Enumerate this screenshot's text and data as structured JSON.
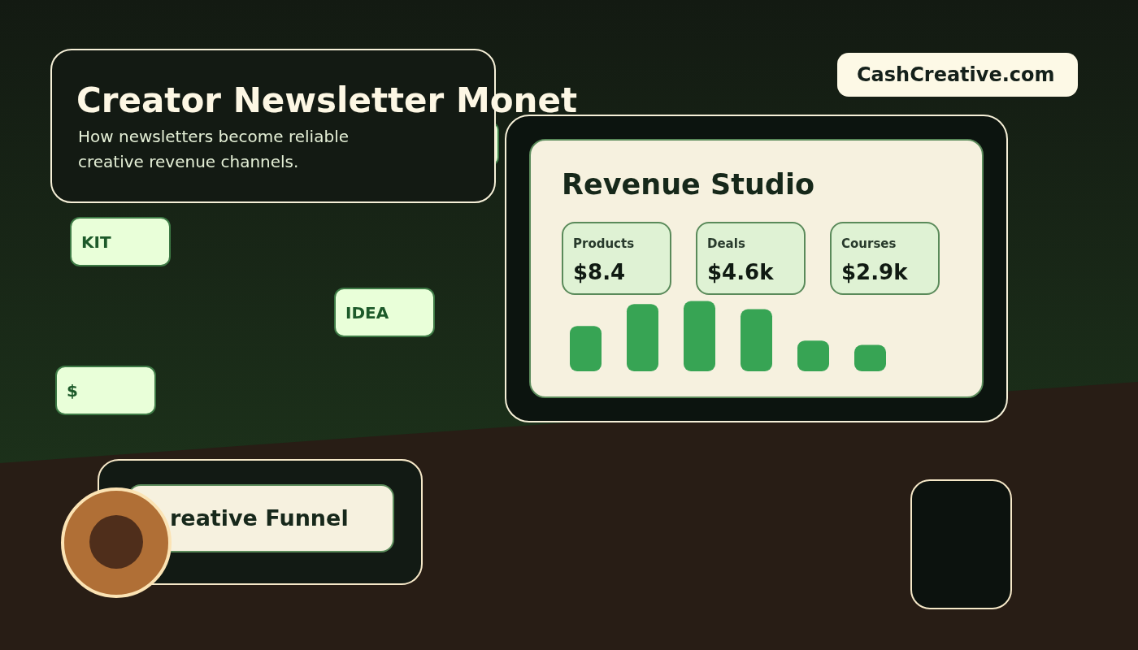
{
  "hero": {
    "title": "Creator Newsletter Monet",
    "subtitle": "How newsletters become reliable creative revenue channels."
  },
  "brand": "CashCreative.com",
  "tags": [
    {
      "label": "KIT"
    },
    {
      "label": "IDEA"
    },
    {
      "label": "$"
    }
  ],
  "dashboard": {
    "title": "Revenue Studio",
    "stats": [
      {
        "label": "Products",
        "value": "$8.4"
      },
      {
        "label": "Deals",
        "value": "$4.6k"
      },
      {
        "label": "Courses",
        "value": "$2.9k"
      }
    ]
  },
  "funnel": {
    "label": "reative Funnel"
  }
}
